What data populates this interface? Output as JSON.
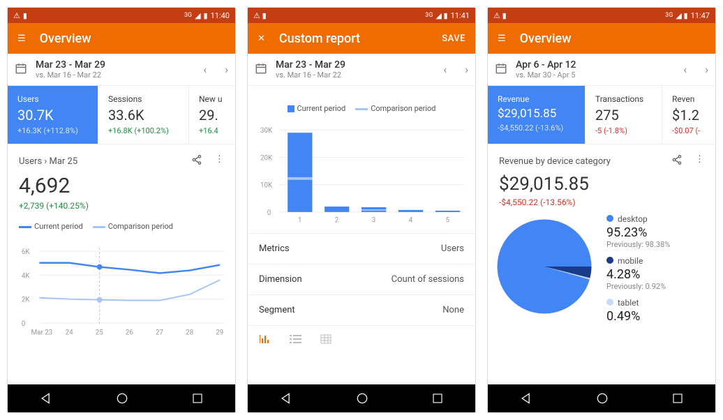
{
  "screens": [
    {
      "status_time": "11:40",
      "appbar_title": "Overview",
      "appbar_action_icon": "menu-icon",
      "date_range": "Mar 23 - Mar 29",
      "date_compare": "vs. Mar 16 - Mar 22",
      "metrics": [
        {
          "label": "Users",
          "value": "30.7K",
          "delta": "+16.3K (+112.8%)",
          "active": true
        },
        {
          "label": "Sessions",
          "value": "33.6K",
          "delta": "+16.8K (+100.2%)"
        },
        {
          "label": "New u",
          "value": "29.",
          "delta": "+16.4"
        }
      ],
      "detail_crumb": "Users › Mar 25",
      "detail_value": "4,692",
      "detail_delta": "+2,739 (+140.25%)",
      "legend_a": "Current period",
      "legend_b": "Comparison period"
    },
    {
      "status_time": "11:41",
      "appbar_title": "Custom report",
      "appbar_action_icon": "close-icon",
      "appbar_save": "SAVE",
      "date_range": "Mar 23 - Mar 29",
      "date_compare": "vs. Mar 16 - Mar 22",
      "legend_a": "Current period",
      "legend_b": "Comparison period",
      "rows": [
        {
          "label": "Metrics",
          "value": "Users"
        },
        {
          "label": "Dimension",
          "value": "Count of sessions"
        },
        {
          "label": "Segment",
          "value": "None"
        }
      ]
    },
    {
      "status_time": "11:47",
      "appbar_title": "Overview",
      "appbar_action_icon": "menu-icon",
      "date_range": "Apr 6 - Apr 12",
      "date_compare": "vs. Mar 30 - Apr 5",
      "metrics": [
        {
          "label": "Revenue",
          "value": "$29,015.85",
          "delta": "-$4,550.22 (-13.6%)",
          "active": true,
          "neg": true
        },
        {
          "label": "Transactions",
          "value": "275",
          "delta": "-5 (-1.8%)",
          "neg": true
        },
        {
          "label": "Reven",
          "value": "$1.2",
          "delta": "-$0.07 (-",
          "neg": true
        }
      ],
      "detail_crumb": "Revenue by device category",
      "detail_value": "$29,015.85",
      "detail_delta": "-$4,550.22 (-13.56%)",
      "pie": [
        {
          "name": "desktop",
          "pct": "95.23%",
          "prev": "Previously: 98.38%",
          "color": "#4285f4"
        },
        {
          "name": "mobile",
          "pct": "4.28%",
          "prev": "Previously: 0.92%",
          "color": "#1a3a8a"
        },
        {
          "name": "tablet",
          "pct": "0.49%",
          "color": "#c7dafb"
        }
      ]
    }
  ],
  "chart_data": [
    {
      "type": "line",
      "title": "Users Mar 25",
      "categories": [
        "Mar 23",
        "24",
        "25",
        "26",
        "27",
        "28",
        "29"
      ],
      "ylim": [
        0,
        6000
      ],
      "yticks": [
        "0",
        "2K",
        "4K",
        "6K"
      ],
      "series": [
        {
          "name": "Current period",
          "color": "#4285f4",
          "values": [
            5000,
            5000,
            4700,
            4500,
            4200,
            4400,
            4900
          ]
        },
        {
          "name": "Comparison period",
          "color": "#a6c5f7",
          "values": [
            2100,
            2000,
            1950,
            1900,
            1900,
            2400,
            3600
          ]
        }
      ],
      "marker_x_index": 2
    },
    {
      "type": "bar",
      "ylim": [
        0,
        30000
      ],
      "yticks": [
        "0",
        "10K",
        "20K",
        "30K"
      ],
      "categories": [
        "1",
        "2",
        "3",
        "4",
        "5"
      ],
      "series": [
        {
          "name": "Current period",
          "color": "#4285f4",
          "values": [
            29000,
            2000,
            1600,
            700,
            500
          ]
        },
        {
          "name": "Comparison period",
          "color": "#a6c5f7",
          "values": [
            12500,
            600,
            700,
            300,
            200
          ]
        }
      ]
    },
    {
      "type": "pie",
      "title": "Revenue by device category",
      "series": [
        {
          "name": "desktop",
          "value": 95.23,
          "color": "#4285f4"
        },
        {
          "name": "mobile",
          "value": 4.28,
          "color": "#1a3a8a"
        },
        {
          "name": "tablet",
          "value": 0.49,
          "color": "#c7dafb"
        }
      ]
    }
  ]
}
